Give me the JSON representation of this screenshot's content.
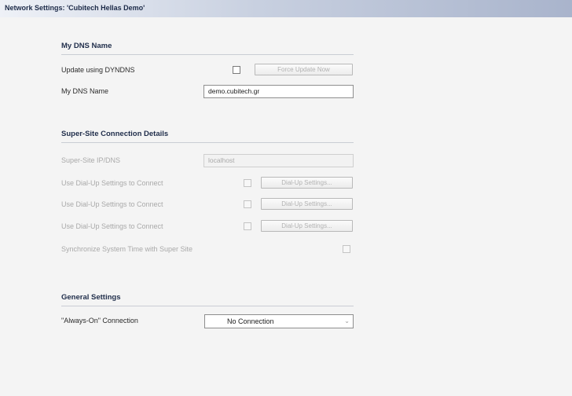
{
  "window": {
    "title": "Network Settings: 'Cubitech Hellas Demo'"
  },
  "dns_section": {
    "title": "My DNS Name",
    "update_dyndns_label": "Update using DYNDNS",
    "update_dyndns_checked": false,
    "force_update_button": "Force Update Now",
    "dns_name_label": "My DNS Name",
    "dns_name_value": "demo.cubitech.gr"
  },
  "supersite_section": {
    "title": "Super-Site Connection Details",
    "ip_dns_label": "Super-Site IP/DNS",
    "ip_dns_value": "localhost",
    "dialup_rows": [
      {
        "label": "Use Dial-Up Settings to Connect",
        "button": "Dial-Up Settings...",
        "checked": false
      },
      {
        "label": "Use Dial-Up Settings to Connect",
        "button": "Dial-Up Settings...",
        "checked": false
      },
      {
        "label": "Use Dial-Up Settings to Connect",
        "button": "Dial-Up Settings...",
        "checked": false
      }
    ],
    "sync_time_label": "Synchronize System Time with Super Site",
    "sync_time_checked": false
  },
  "general_section": {
    "title": "General Settings",
    "always_on_label": "\"Always-On\" Connection",
    "always_on_value": "No Connection"
  },
  "icons": {
    "dropdown": "chevron-down-icon"
  },
  "colors": {
    "title_bar_start": "#eef1f7",
    "title_bar_end": "#a9b4cc",
    "section_title": "#1f2d4a",
    "disabled_text": "#a9a9a9"
  }
}
